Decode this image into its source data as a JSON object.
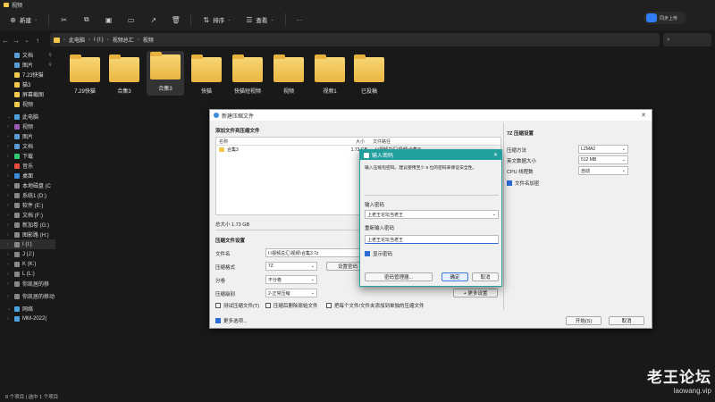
{
  "window": {
    "title": "视频"
  },
  "toolbar": {
    "new_label": "新建",
    "sort_label": "排序",
    "view_label": "查看",
    "more_label": "···",
    "baidu_label": "同步上传"
  },
  "address": {
    "crumbs": [
      "此电脑",
      "I (I:)",
      "视频总汇",
      "视频"
    ]
  },
  "sidebar": {
    "items": [
      {
        "label": "文档",
        "color": "#5a9bd5",
        "pin": "📌"
      },
      {
        "label": "图片",
        "color": "#5a9bd5",
        "pin": "📌"
      },
      {
        "label": "7.23快猫",
        "color": "#f2c94c",
        "pin": ""
      },
      {
        "label": "猫3",
        "color": "#f2c94c",
        "pin": ""
      },
      {
        "label": "屏幕截图",
        "color": "#f2c94c",
        "pin": ""
      },
      {
        "label": "视频",
        "color": "#f2c94c",
        "pin": ""
      },
      {
        "label": "此电脑",
        "color": "#4aa3df",
        "pin": "",
        "chev": "⌄",
        "section": true
      },
      {
        "label": "视频",
        "color": "#9b59b6",
        "chev": "›"
      },
      {
        "label": "图片",
        "color": "#5a9bd5",
        "chev": "›"
      },
      {
        "label": "文档",
        "color": "#5a9bd5",
        "chev": "›"
      },
      {
        "label": "下载",
        "color": "#2ecc71",
        "chev": "›"
      },
      {
        "label": "音乐",
        "color": "#e74c3c",
        "chev": "›"
      },
      {
        "label": "桌面",
        "color": "#3a8dde",
        "chev": "›"
      },
      {
        "label": "本地磁盘 (C",
        "color": "#888",
        "chev": "›"
      },
      {
        "label": "系统1 (D:)",
        "color": "#888",
        "chev": "›"
      },
      {
        "label": "软件 (E:)",
        "color": "#888",
        "chev": "›"
      },
      {
        "label": "文档 (F:)",
        "color": "#888",
        "chev": "›"
      },
      {
        "label": "新加卷 (G:)",
        "color": "#888",
        "chev": "›"
      },
      {
        "label": "图影路 (H:)",
        "color": "#888",
        "chev": "›"
      },
      {
        "label": "I (I:)",
        "color": "#888",
        "chev": "›",
        "selected": true
      },
      {
        "label": "J (J:)",
        "color": "#888",
        "chev": "›"
      },
      {
        "label": "K (K:)",
        "color": "#888",
        "chev": "›"
      },
      {
        "label": "L (L:)",
        "color": "#888",
        "chev": "›"
      },
      {
        "label": "你凯居的移",
        "color": "#888",
        "chev": "›"
      },
      {
        "label": "你凯居的移动",
        "color": "#888",
        "chev": "›",
        "section": true
      },
      {
        "label": "网络",
        "color": "#4aa3df",
        "chev": "⌄",
        "section": true
      },
      {
        "label": "MM-2022(",
        "color": "#4aa3df",
        "chev": "›"
      }
    ]
  },
  "folders": [
    {
      "label": "7.29快猫"
    },
    {
      "label": "合集3"
    },
    {
      "label": "合集3",
      "selected": true
    },
    {
      "label": "快猫"
    },
    {
      "label": "快猫短视频"
    },
    {
      "label": "视频"
    },
    {
      "label": "视频1"
    },
    {
      "label": "已投稿"
    }
  ],
  "status": {
    "text": "8 个项目 | 选中 1 个项目"
  },
  "dialog": {
    "title": "新建压缩文件",
    "add_label": "添加文件到压缩文件",
    "col_name": "名称",
    "col_size": "大小",
    "col_path": "文件路径",
    "file_name": "合集3",
    "file_size": "1.73 GB",
    "file_path": "I:\\视频总汇\\视频\\合集3\\",
    "total_size": "总大小 1.73 GB",
    "settings_label": "压缩文件设置",
    "filename_label": "文件名",
    "filename_value": "I:\\视频总汇\\视频\\合集3.7z",
    "format_label": "压缩格式",
    "format_value": "7Z",
    "set_password_button": "设置密码",
    "split_label": "分卷",
    "split_value": "不分卷",
    "level_label": "压缩级别",
    "level_value": "2-正常压缩",
    "more_settings_button": "+ 更多设置",
    "opt_test": "测试压缩文件(T)",
    "opt_delete": "压缩后删除原始文件",
    "opt_each": "把每个文件/文件夹添加到单独的压缩文件",
    "more_options": "更多选项...",
    "start_button": "开始(S)",
    "cancel_button": "取消",
    "right_title": "7Z 压缩设置",
    "method_label": "压缩方法",
    "method_value": "LZMA2",
    "dict_label": "英文数据大小",
    "dict_value": "512 MB",
    "cpu_label": "CPU 线程数",
    "cpu_value": "自动",
    "encrypt_names": "文件名加密"
  },
  "pw": {
    "title": "输入密码",
    "desc": "输入压缩包密码。建议使用至少 8 位的密码来保证安全性。",
    "enter_label": "输入密码",
    "enter_value": "上老王论坛当老王",
    "reenter_label": "重新输入密码",
    "reenter_value": "上老王论坛当老王",
    "show_password": "显示密码",
    "manager_button": "密码管理器...",
    "ok_button": "确定",
    "cancel_button": "取消"
  },
  "watermark": {
    "line1": "老王论坛",
    "line2": "laowang.vip"
  }
}
